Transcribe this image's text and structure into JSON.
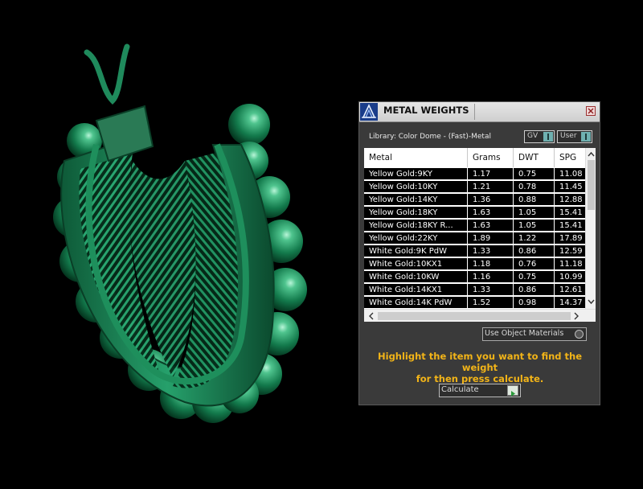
{
  "panel": {
    "title": "METAL WEIGHTS",
    "library_label": "Library: Color Dome - (Fast)-Metal",
    "gv_label": "GV",
    "user_label": "User",
    "use_object_materials_label": "Use Object Materials",
    "instructions_line1": "Highlight the item you want to find the weight",
    "instructions_line2": "for then press calculate.",
    "calculate_label": "Calculate"
  },
  "table": {
    "columns": [
      "Metal",
      "Grams",
      "DWT",
      "SPG"
    ],
    "rows": [
      {
        "metal": "Yellow Gold:9KY",
        "grams": "1.17",
        "dwt": "0.75",
        "spg": "11.08"
      },
      {
        "metal": "Yellow Gold:10KY",
        "grams": "1.21",
        "dwt": "0.78",
        "spg": "11.45"
      },
      {
        "metal": "Yellow Gold:14KY",
        "grams": "1.36",
        "dwt": "0.88",
        "spg": "12.88"
      },
      {
        "metal": "Yellow Gold:18KY",
        "grams": "1.63",
        "dwt": "1.05",
        "spg": "15.41"
      },
      {
        "metal": "Yellow Gold:18KY R...",
        "grams": "1.63",
        "dwt": "1.05",
        "spg": "15.41"
      },
      {
        "metal": "Yellow Gold:22KY",
        "grams": "1.89",
        "dwt": "1.22",
        "spg": "17.89"
      },
      {
        "metal": "White Gold:9K PdW",
        "grams": "1.33",
        "dwt": "0.86",
        "spg": "12.59"
      },
      {
        "metal": "White Gold:10KX1",
        "grams": "1.18",
        "dwt": "0.76",
        "spg": "11.18"
      },
      {
        "metal": "White Gold:10KW",
        "grams": "1.16",
        "dwt": "0.75",
        "spg": "10.99"
      },
      {
        "metal": "White Gold:14KX1",
        "grams": "1.33",
        "dwt": "0.86",
        "spg": "12.61"
      },
      {
        "metal": "White Gold:14K PdW",
        "grams": "1.52",
        "dwt": "0.98",
        "spg": "14.37"
      }
    ]
  },
  "colors": {
    "model_green": "#1f8a5c",
    "instruction_yellow": "#f2b418",
    "panel_bg": "#3a3a3a"
  }
}
